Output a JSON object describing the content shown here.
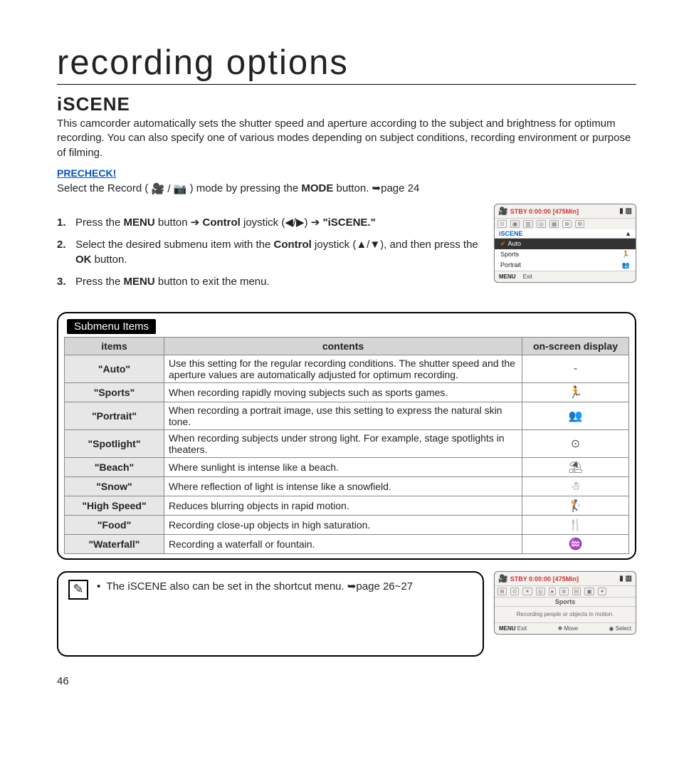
{
  "page_title": "recording options",
  "section_heading_lower": "i",
  "section_heading_upper": "SCENE",
  "intro": "This camcorder automatically sets the shutter speed and aperture according to the subject and brightness for optimum recording. You can also specify one of various modes depending on subject conditions, recording environment or purpose of filming.",
  "precheck_label": "PRECHECK!",
  "precheck_body_1": "Select the Record ( ",
  "precheck_icons": "🎥 / 📷",
  "precheck_body_2": " ) mode by pressing the ",
  "precheck_bold": "MODE",
  "precheck_body_3": " button. ➥page 24",
  "steps": [
    {
      "num": "1.",
      "parts": [
        "Press the ",
        "MENU",
        " button ➔ ",
        "Control",
        " joystick (◀/▶) ➔ ",
        "\"iSCENE.\"",
        ""
      ]
    },
    {
      "num": "2.",
      "parts": [
        "Select the desired submenu item with the ",
        "Control",
        " joystick (▲/▼), and then press the ",
        "OK",
        " button."
      ]
    },
    {
      "num": "3.",
      "parts": [
        "Press the ",
        "MENU",
        " button to exit the menu."
      ]
    }
  ],
  "lcd1": {
    "top": "STBY 0:00:00 [475Min]",
    "menu_head": "iSCENE",
    "row1": "Auto",
    "row2": "Sports",
    "row3": "Portrait",
    "bot_menu": "MENU",
    "bot_exit": "Exit"
  },
  "lcd2": {
    "top": "STBY 0:00:00 [475Min]",
    "mode": "Sports",
    "desc": "Recording people or objects in motion.",
    "bot_menu": "MENU",
    "bot_exit": "Exit",
    "bot_move": "Move",
    "bot_select": "Select"
  },
  "table_tab": "Submenu Items",
  "table_head": {
    "c1": "items",
    "c2": "contents",
    "c3": "on-screen display"
  },
  "table_rows": [
    {
      "name": "\"Auto\"",
      "desc": "Use this setting for the regular recording conditions. The shutter speed and the aperture values are automatically adjusted for optimum recording.",
      "osd": "-"
    },
    {
      "name": "\"Sports\"",
      "desc": "When recording rapidly moving subjects such as sports games.",
      "osd": "🏃"
    },
    {
      "name": "\"Portrait\"",
      "desc": "When recording a portrait image, use this setting to express the natural skin tone.",
      "osd": "👥"
    },
    {
      "name": "\"Spotlight\"",
      "desc": "When recording subjects under strong light. For example, stage spotlights in theaters.",
      "osd": "⊙"
    },
    {
      "name": "\"Beach\"",
      "desc": "Where sunlight is intense like a beach.",
      "osd": "⛱"
    },
    {
      "name": "\"Snow\"",
      "desc": "Where reflection of light is intense like a snowfield.",
      "osd": "☃"
    },
    {
      "name": "\"High Speed\"",
      "desc": "Reduces blurring objects in rapid motion.",
      "osd": "🏌"
    },
    {
      "name": "\"Food\"",
      "desc": "Recording close-up objects in high saturation.",
      "osd": "🍴"
    },
    {
      "name": "\"Waterfall\"",
      "desc": "Recording a waterfall or fountain.",
      "osd": "♒"
    }
  ],
  "note_bullet": "•",
  "note_text": "The iSCENE also can be set in the shortcut menu. ➥page 26~27",
  "page_number": "46"
}
